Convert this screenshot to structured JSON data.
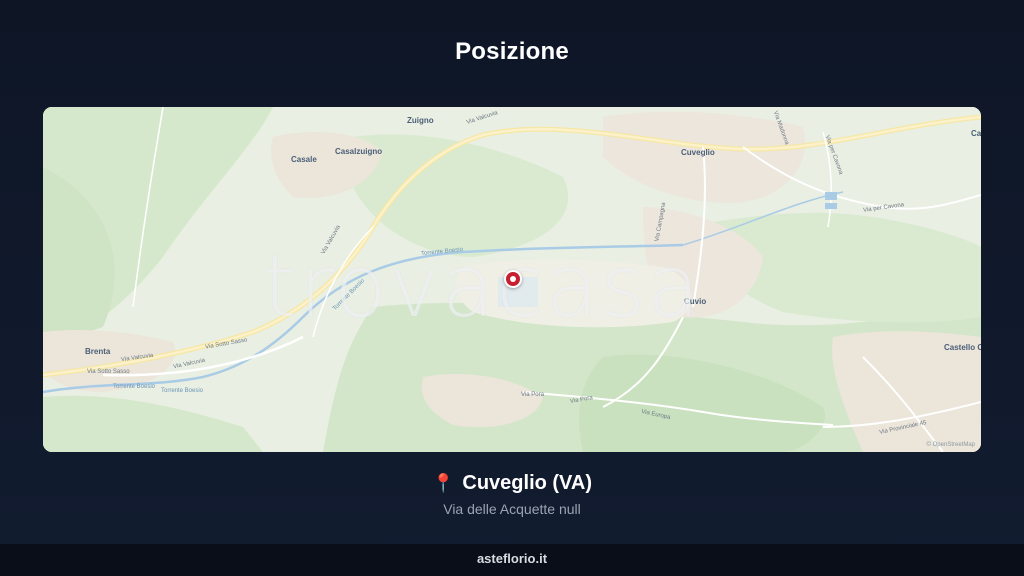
{
  "page": {
    "title": "Posizione"
  },
  "map": {
    "watermark": "trovacasa",
    "attribution": "© OpenStreetMap",
    "places": [
      "Zuigno",
      "Casale",
      "Casalzuigno",
      "Cuveglio",
      "Cuvio",
      "Brenta",
      "Castello C",
      "Ca"
    ],
    "roads": [
      "Via Valcuvia",
      "Via Valcuvia",
      "Via Valcuvia",
      "Via Valcuvia",
      "Via Sotto Sasso",
      "Via Sotto Sasso",
      "Via Pora",
      "Via Pora",
      "Via Europa",
      "Via per Cavona",
      "Via per Cavona",
      "Via Provinciale 45",
      "Via Madonna",
      "Via Campagna"
    ],
    "waters": [
      "Torrente Boesio",
      "Torrente Boesio",
      "Torrente Boesio",
      "Torrente Boesio"
    ]
  },
  "location": {
    "pin_icon": "📍",
    "city": "Cuveglio (VA)",
    "address": "Via delle Acquette null"
  },
  "footer": {
    "site": "asteflorio.it"
  },
  "colors": {
    "background": "#0e1626",
    "pin": "#c62030",
    "map_green": "#dcebd3"
  }
}
